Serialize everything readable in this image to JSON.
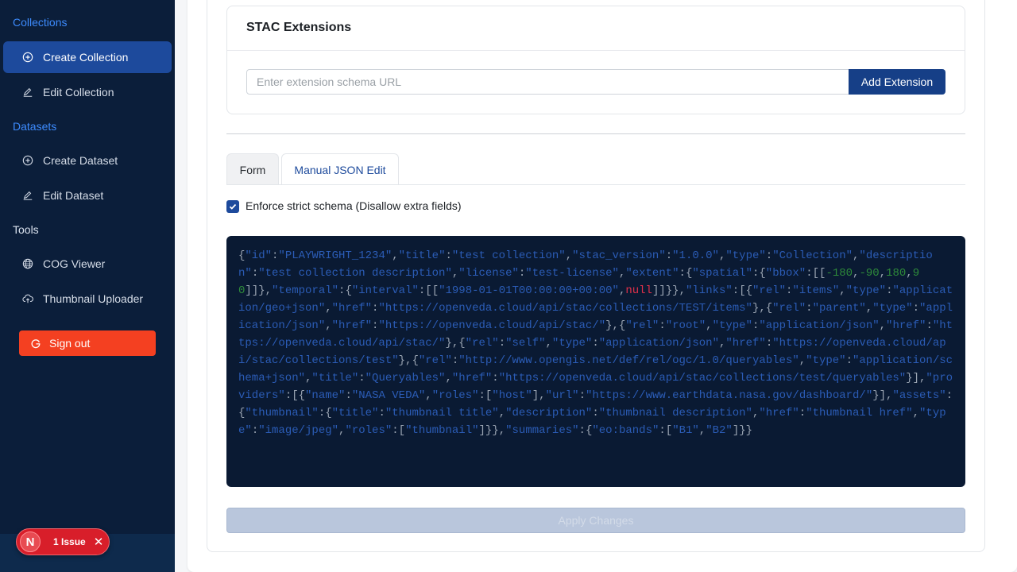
{
  "sidebar": {
    "collections_title": "Collections",
    "datasets_title": "Datasets",
    "tools_title": "Tools",
    "items": [
      {
        "label": "Create Collection"
      },
      {
        "label": "Edit Collection"
      },
      {
        "label": "Create Dataset"
      },
      {
        "label": "Edit Dataset"
      },
      {
        "label": "COG Viewer"
      },
      {
        "label": "Thumbnail Uploader"
      }
    ],
    "sign_out": "Sign out"
  },
  "issues": {
    "badge": "N",
    "label": "1 Issue"
  },
  "extensions": {
    "title": "STAC Extensions",
    "placeholder": "Enter extension schema URL",
    "button": "Add Extension"
  },
  "tabs": {
    "form": "Form",
    "json": "Manual JSON Edit"
  },
  "strict_label": "Enforce strict schema (Disallow extra fields)",
  "json_text": "{\"id\":\"PLAYWRIGHT_1234\",\"title\":\"test collection\",\"stac_version\":\"1.0.0\",\"type\":\"Collection\",\"description\":\"test collection description\",\"license\":\"test-license\",\"extent\":{\"spatial\":{\"bbox\":[[-180,-90,180,90]]},\"temporal\":{\"interval\":[[\"1998-01-01T00:00:00+00:00\",null]]}},\"links\":[{\"rel\":\"items\",\"type\":\"application/geo+json\",\"href\":\"https://openveda.cloud/api/stac/collections/TEST/items\"},{\"rel\":\"parent\",\"type\":\"application/json\",\"href\":\"https://openveda.cloud/api/stac/\"},{\"rel\":\"root\",\"type\":\"application/json\",\"href\":\"https://openveda.cloud/api/stac/\"},{\"rel\":\"self\",\"type\":\"application/json\",\"href\":\"https://openveda.cloud/api/stac/collections/test\"},{\"rel\":\"http://www.opengis.net/def/rel/ogc/1.0/queryables\",\"type\":\"application/schema+json\",\"title\":\"Queryables\",\"href\":\"https://openveda.cloud/api/stac/collections/test/queryables\"}],\"providers\":[{\"name\":\"NASA VEDA\",\"roles\":[\"host\"],\"url\":\"https://www.earthdata.nasa.gov/dashboard/\"}],\"assets\":{\"thumbnail\":{\"title\":\"thumbnail title\",\"description\":\"thumbnail description\",\"href\":\"thumbnail href\",\"type\":\"image/jpeg\",\"roles\":[\"thumbnail\"]}},\"summaries\":{\"eo:bands\":[\"B1\",\"B2\"]}}",
  "apply_label": "Apply Changes",
  "colors": {
    "sidebar_bg": "#0b1e3a",
    "active_item": "#1d4a9c",
    "sign_out": "#f44021",
    "primary": "#163f87",
    "editor_bg": "#0a1a33"
  }
}
